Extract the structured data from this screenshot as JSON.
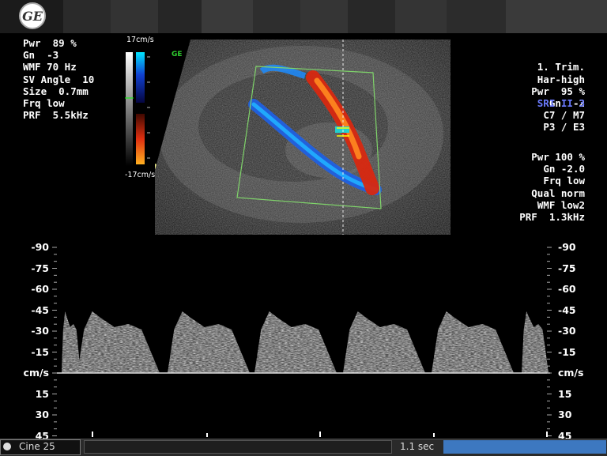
{
  "header": {
    "logo_text": "GE"
  },
  "left_params": [
    "Pwr  89 %",
    "Gn  -3",
    "WMF 70 Hz",
    "SV Angle  10",
    "Size  0.7mm",
    "Frq low",
    "PRF  5.5kHz"
  ],
  "right_params_top": [
    "1. Trim.",
    "Har-high",
    "Pwr  95 %",
    "Gn  -2",
    "C7 / M7",
    "P3 / E3"
  ],
  "right_params_accent": "SRI II 3",
  "right_params_bottom": [
    "Pwr 100 %",
    "Gn -2.0",
    "Frq low",
    "Qual norm",
    "WMF low2",
    "PRF  1.3kHz"
  ],
  "color_bar": {
    "top_label": "17cm/s",
    "bottom_label": "-17cm/s",
    "green_tag": "GE"
  },
  "spectral": {
    "neg_labels": [
      "-90",
      "-75",
      "-60",
      "-45",
      "-30",
      "-15"
    ],
    "unit": "cm/s",
    "pos_labels": [
      "15",
      "30",
      "45"
    ]
  },
  "footer": {
    "cine_label": "Cine 25",
    "time_label": "1.1 sec",
    "cine_progress": 1.0
  },
  "colors": {
    "accent_blue": "#6b7bff",
    "progress_blue": "#3d78c0",
    "color_box": "#7fd36a"
  }
}
